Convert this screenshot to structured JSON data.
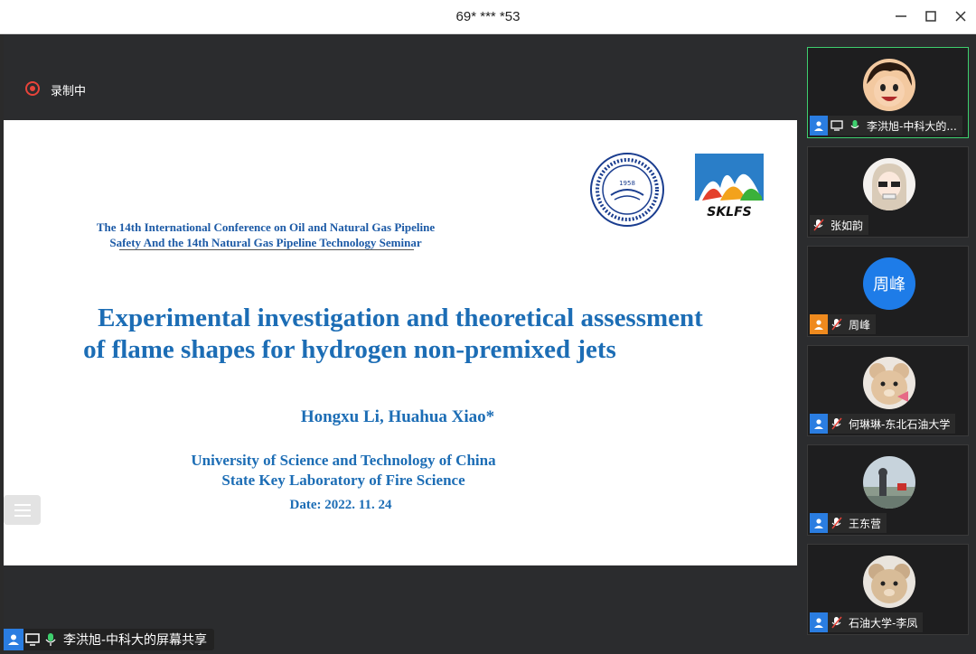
{
  "window": {
    "title": "69* *** *53"
  },
  "recording": {
    "label": "录制中"
  },
  "slide": {
    "conference_line1": "The 14th International Conference on Oil and Natural Gas Pipeline",
    "conference_line2": "Safety And the 14th Natural Gas Pipeline Technology Seminar",
    "title_line1": "Experimental investigation and theoretical assessment",
    "title_line2": "of flame shapes for hydrogen non-premixed jets",
    "authors": "Hongxu Li, Huahua Xiao*",
    "affiliation1": "University of Science and Technology of China",
    "affiliation2": "State Key Laboratory of Fire Science",
    "date": "Date: 2022. 11. 24",
    "logo_ustc_year": "1958",
    "logo_sklfs_text": "SKLFS"
  },
  "share": {
    "label": "李洪旭-中科大的屏幕共享"
  },
  "participants": [
    {
      "name": "李洪旭-中科大的...",
      "active": true,
      "role": "host",
      "muted": false
    },
    {
      "name": "张如韵",
      "active": false,
      "role": "none",
      "muted": true
    },
    {
      "name": "周峰",
      "active": false,
      "role": "cohost",
      "muted": true,
      "avatar_text": "周峰"
    },
    {
      "name": "何琳琳-东北石油大学",
      "active": false,
      "role": "host",
      "muted": true
    },
    {
      "name": "王东营",
      "active": false,
      "role": "host",
      "muted": true
    },
    {
      "name": "石油大学-李凤",
      "active": false,
      "role": "host",
      "muted": true
    }
  ],
  "colors": {
    "accent": "#2a7de1",
    "active_border": "#3ecf6e",
    "recording": "#e8443a",
    "slide_text": "#1c6db5"
  }
}
